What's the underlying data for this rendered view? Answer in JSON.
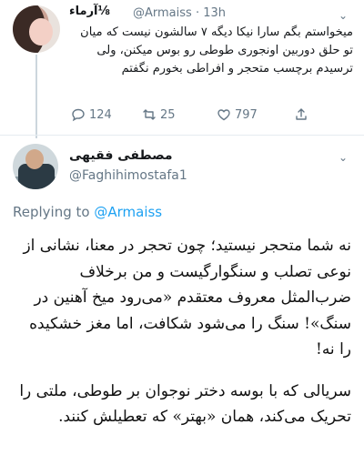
{
  "reply_tweet": {
    "author_name": "آرماء⅛",
    "handle": "@Armaiss",
    "time": "· 13h",
    "text": "میخواستم بگم سارا نیکا دیگه ۷ سالشون نیست که میان تو حلق دوربین اونجوری طوطی رو بوس میکنن، ولی ترسیدم برچسب متحجر و افراطی بخورم نگفتم",
    "actions": {
      "reply_count": "124",
      "retweet_count": "25",
      "like_count": "797"
    }
  },
  "main_tweet": {
    "author_name": "مصطفی فقیهی",
    "handle": "@Faghihimostafa1",
    "replying_prefix": "Replying to",
    "replying_mention": "@Armaiss",
    "paragraph_1": "نه شما متحجر نیستید؛ چون تحجر در معنا، نشانی از نوعی تصلب و سنگوارگیست و من برخلاف ضرب‌المثل معروف معتقدم «می‌رود میخ آهنین در سنگ»! سنگ را می‌شود شکافت، اما مغز خشکیده را نه!",
    "paragraph_2": "سریالی که با بوسه دختر نوجوان بر طوطی، ملتی را تحریک می‌کند، همان «بهتر» که تعطیلش کنند."
  },
  "colors": {
    "accent": "#1da1f2",
    "muted": "#657786",
    "divider": "#e6ecf0"
  }
}
